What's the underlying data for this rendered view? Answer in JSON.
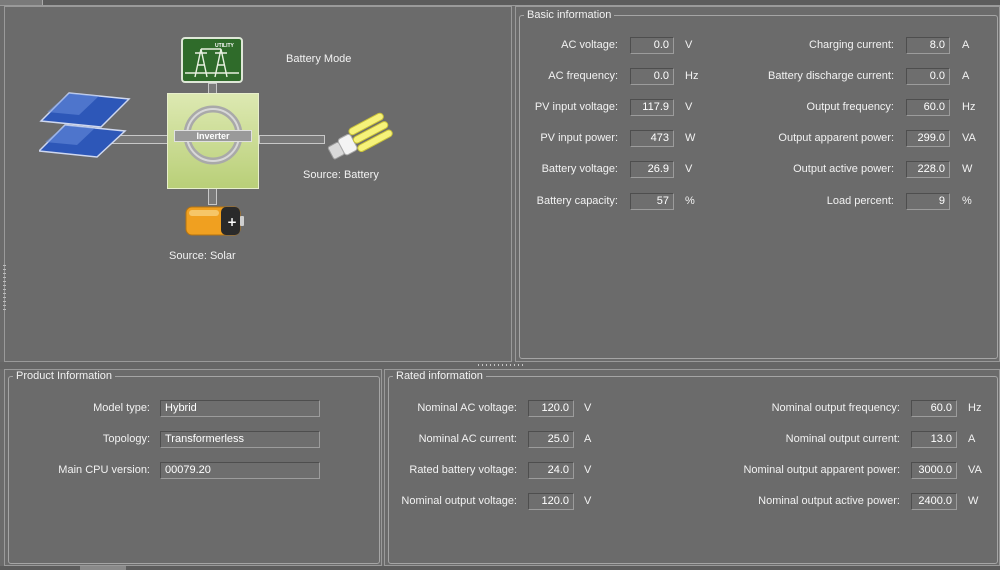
{
  "diagram": {
    "mode_label": "Battery Mode",
    "utility_label": "UTILITY",
    "inverter_label": "Inverter",
    "load_source": "Source:  Battery",
    "battery_source": "Source:  Solar"
  },
  "basic": {
    "title": "Basic information",
    "left": [
      {
        "label": "AC voltage:",
        "value": "0.0",
        "unit": "V"
      },
      {
        "label": "AC frequency:",
        "value": "0.0",
        "unit": "Hz"
      },
      {
        "label": "PV input voltage:",
        "value": "117.9",
        "unit": "V"
      },
      {
        "label": "PV input power:",
        "value": "473",
        "unit": "W"
      },
      {
        "label": "Battery voltage:",
        "value": "26.9",
        "unit": "V"
      },
      {
        "label": "Battery capacity:",
        "value": "57",
        "unit": "%"
      }
    ],
    "right": [
      {
        "label": "Charging current:",
        "value": "8.0",
        "unit": "A"
      },
      {
        "label": "Battery discharge current:",
        "value": "0.0",
        "unit": "A"
      },
      {
        "label": "Output frequency:",
        "value": "60.0",
        "unit": "Hz"
      },
      {
        "label": "Output apparent power:",
        "value": "299.0",
        "unit": "VA"
      },
      {
        "label": "Output active power:",
        "value": "228.0",
        "unit": "W"
      },
      {
        "label": "Load percent:",
        "value": "9",
        "unit": "%"
      }
    ]
  },
  "product": {
    "title": "Product Information",
    "rows": [
      {
        "label": "Model type:",
        "value": "Hybrid"
      },
      {
        "label": "Topology:",
        "value": "Transformerless"
      },
      {
        "label": "Main CPU version:",
        "value": "00079.20"
      }
    ]
  },
  "rated": {
    "title": "Rated information",
    "left": [
      {
        "label": "Nominal AC voltage:",
        "value": "120.0",
        "unit": "V"
      },
      {
        "label": "Nominal AC current:",
        "value": "25.0",
        "unit": "A"
      },
      {
        "label": "Rated battery voltage:",
        "value": "24.0",
        "unit": "V"
      },
      {
        "label": "Nominal output voltage:",
        "value": "120.0",
        "unit": "V"
      }
    ],
    "right": [
      {
        "label": "Nominal output frequency:",
        "value": "60.0",
        "unit": "Hz"
      },
      {
        "label": "Nominal output current:",
        "value": "13.0",
        "unit": "A"
      },
      {
        "label": "Nominal output apparent power:",
        "value": "3000.0",
        "unit": "VA"
      },
      {
        "label": "Nominal output active power:",
        "value": "2400.0",
        "unit": "W"
      }
    ]
  },
  "colors": {
    "background": "#6b6b6b",
    "inverter": "#c7d98a",
    "utility": "#2f6b2a",
    "battery_body": "#f0a020"
  }
}
